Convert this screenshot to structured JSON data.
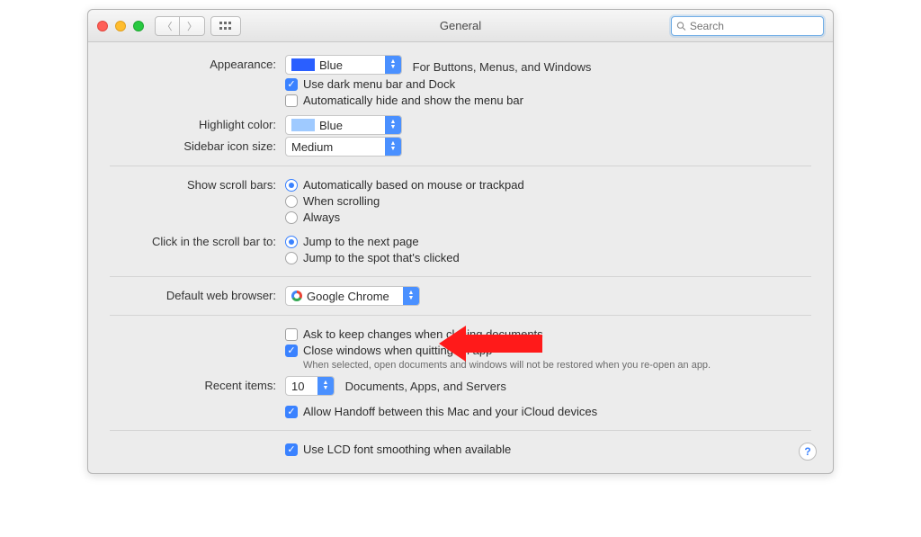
{
  "window": {
    "title": "General"
  },
  "search": {
    "placeholder": "Search"
  },
  "labels": {
    "appearance": "Appearance:",
    "highlight": "Highlight color:",
    "sidebar_icon": "Sidebar icon size:",
    "scroll_bars": "Show scroll bars:",
    "click_scroll": "Click in the scroll bar to:",
    "default_browser": "Default web browser:",
    "recent_items": "Recent items:"
  },
  "appearance": {
    "value": "Blue",
    "hint": "For Buttons, Menus, and Windows",
    "check_dark": "Use dark menu bar and Dock",
    "check_autohide": "Automatically hide and show the menu bar"
  },
  "highlight": {
    "value": "Blue"
  },
  "sidebar": {
    "value": "Medium"
  },
  "scroll": {
    "opt1": "Automatically based on mouse or trackpad",
    "opt2": "When scrolling",
    "opt3": "Always"
  },
  "click": {
    "opt1": "Jump to the next page",
    "opt2": "Jump to the spot that's clicked"
  },
  "browser": {
    "value": "Google Chrome"
  },
  "documents": {
    "ask_keep": "Ask to keep changes when closing documents",
    "close_windows": "Close windows when quitting an app",
    "close_note": "When selected, open documents and windows will not be restored when you re-open an app."
  },
  "recent": {
    "value": "10",
    "suffix": "Documents, Apps, and Servers"
  },
  "handoff": "Allow Handoff between this Mac and your iCloud devices",
  "lcd": "Use LCD font smoothing when available"
}
